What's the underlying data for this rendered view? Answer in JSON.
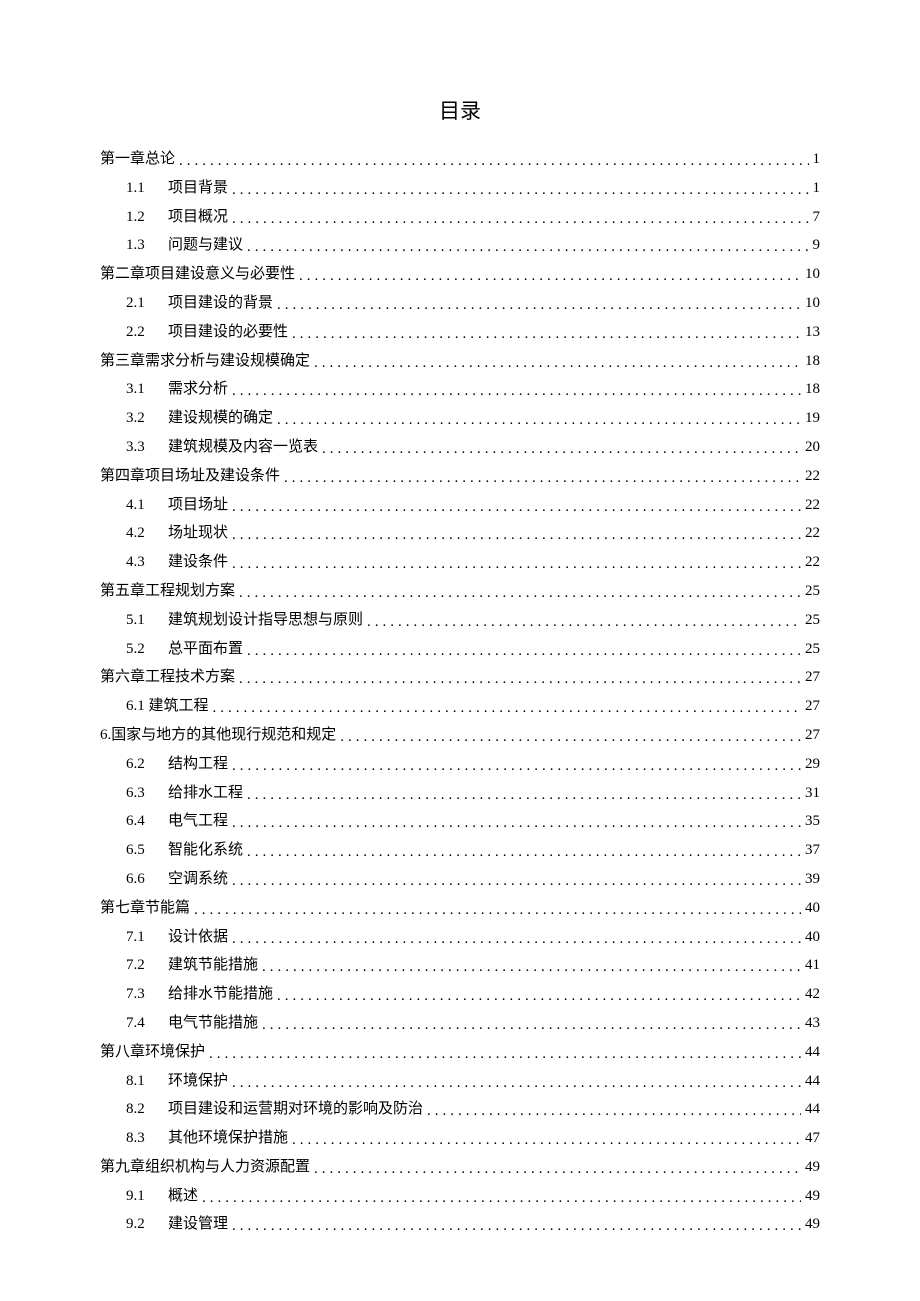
{
  "title": "目录",
  "entries": [
    {
      "level": 1,
      "num": "",
      "label": "第一章总论",
      "page": "1"
    },
    {
      "level": 2,
      "num": "1.1",
      "label": "项目背景",
      "page": "1"
    },
    {
      "level": 2,
      "num": "1.2",
      "label": "项目概况",
      "page": "7"
    },
    {
      "level": 2,
      "num": "1.3",
      "label": "问题与建议",
      "page": "9"
    },
    {
      "level": 1,
      "num": "第二章",
      "label": "项目建设意义与必要性",
      "page": "10"
    },
    {
      "level": 2,
      "num": "2.1",
      "label": "项目建设的背景",
      "page": "10"
    },
    {
      "level": 2,
      "num": "2.2",
      "label": "项目建设的必要性",
      "page": "13"
    },
    {
      "level": 1,
      "num": "",
      "label": "第三章需求分析与建设规模确定",
      "page": "18"
    },
    {
      "level": 2,
      "num": "3.1",
      "label": "需求分析",
      "page": "18"
    },
    {
      "level": 2,
      "num": "3.2",
      "label": "建设规模的确定",
      "page": "19"
    },
    {
      "level": 2,
      "num": "3.3",
      "label": "建筑规模及内容一览表",
      "page": "20"
    },
    {
      "level": 1,
      "num": "第四章",
      "label": "项目场址及建设条件",
      "page": "22"
    },
    {
      "level": 2,
      "num": "4.1",
      "label": "项目场址",
      "page": "22"
    },
    {
      "level": 2,
      "num": "4.2",
      "label": "场址现状",
      "page": "22"
    },
    {
      "level": 2,
      "num": "4.3",
      "label": "建设条件",
      "page": "22"
    },
    {
      "level": 1,
      "num": "",
      "label": "第五章工程规划方案",
      "page": "25"
    },
    {
      "level": 2,
      "num": "5.1",
      "label": "建筑规划设计指导思想与原则",
      "page": "25"
    },
    {
      "level": 2,
      "num": "5.2",
      "label": "总平面布置",
      "page": "25"
    },
    {
      "level": 1,
      "num": "",
      "label": "第六章工程技术方案",
      "page": "27"
    },
    {
      "level": 2,
      "num": "",
      "label": "6.1 建筑工程",
      "page": "27"
    },
    {
      "level": 1,
      "num": "",
      "label": "6.国家与地方的其他现行规范和规定",
      "page": "27"
    },
    {
      "level": 2,
      "num": "6.2",
      "label": "结构工程",
      "page": "29"
    },
    {
      "level": 2,
      "num": "6.3",
      "label": "给排水工程",
      "page": "31"
    },
    {
      "level": 2,
      "num": "6.4",
      "label": "电气工程",
      "page": "35"
    },
    {
      "level": 2,
      "num": "6.5",
      "label": "智能化系统",
      "page": "37"
    },
    {
      "level": 2,
      "num": "6.6",
      "label": "空调系统",
      "page": "39"
    },
    {
      "level": 1,
      "num": "",
      "label": "第七章节能篇",
      "page": "40"
    },
    {
      "level": 2,
      "num": "7.1",
      "label": "设计依据",
      "page": "40"
    },
    {
      "level": 2,
      "num": "7.2",
      "label": "建筑节能措施",
      "page": "41"
    },
    {
      "level": 2,
      "num": "7.3",
      "label": "给排水节能措施",
      "page": "42"
    },
    {
      "level": 2,
      "num": "7.4",
      "label": "电气节能措施",
      "page": "43"
    },
    {
      "level": 1,
      "num": "",
      "label": "第八章环境保护",
      "page": "44"
    },
    {
      "level": 2,
      "num": "8.1",
      "label": "环境保护",
      "page": "44"
    },
    {
      "level": 2,
      "num": "8.2",
      "label": "项目建设和运营期对环境的影响及防治",
      "page": "44"
    },
    {
      "level": 2,
      "num": "8.3",
      "label": "其他环境保护措施",
      "page": "47"
    },
    {
      "level": 1,
      "num": "",
      "label": "第九章组织机构与人力资源配置",
      "page": "49"
    },
    {
      "level": 2,
      "num": "9.1",
      "label": "概述",
      "page": "49"
    },
    {
      "level": 2,
      "num": "9.2",
      "label": "建设管理",
      "page": "49"
    }
  ]
}
